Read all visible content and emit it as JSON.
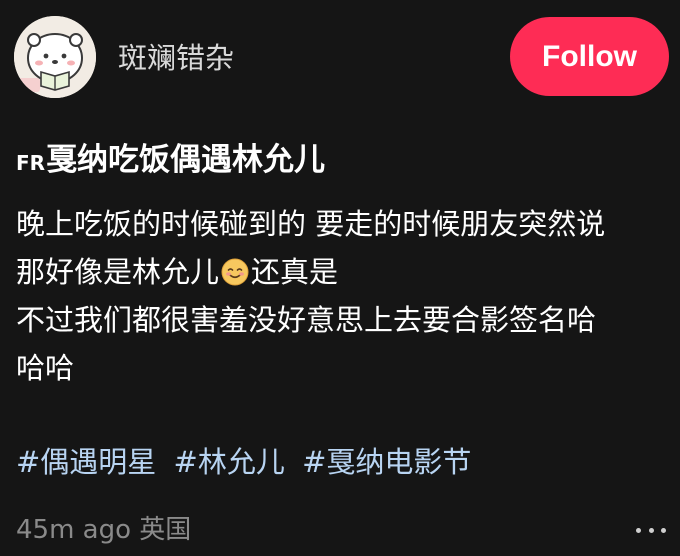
{
  "author": {
    "username": "斑斓错杂",
    "avatar_icon": "bear-reading-avatar"
  },
  "follow_label": "Follow",
  "colors": {
    "background": "#151515",
    "follow_button": "#fe2c55",
    "hashtag": "#b8d4f2",
    "meta_text": "#8a8a8a"
  },
  "post": {
    "title_prefix": "FR",
    "title": "戛纳吃饭偶遇林允儿",
    "body_line1": "晚上吃饭的时候碰到的 要走的时候朋友突然说",
    "body_line2a": "那好像是林允儿",
    "body_emoji": "smiling-face-emoji",
    "body_line2b": "还真是",
    "body_line3": "不过我们都很害羞没好意思上去要合影签名哈",
    "body_line4": "哈哈",
    "hashtags": [
      "#偶遇明星",
      "#林允儿",
      "#戛纳电影节"
    ],
    "time_ago": "45m ago",
    "location": "英国"
  }
}
